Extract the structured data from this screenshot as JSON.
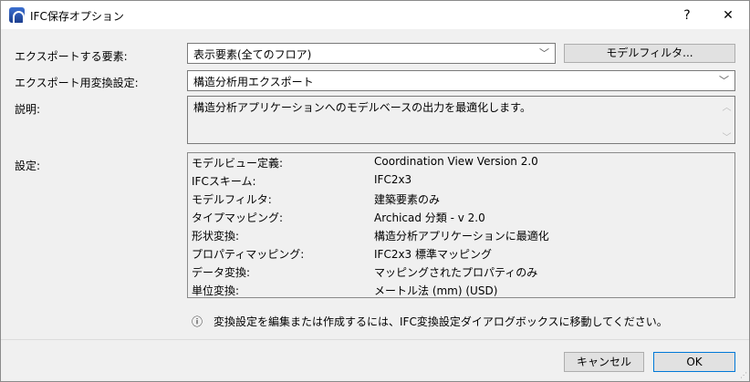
{
  "window": {
    "title": "IFC保存オプション",
    "help": "?",
    "close": "✕"
  },
  "form": {
    "elements_label": "エクスポートする要素:",
    "elements_value": "表示要素(全てのフロア)",
    "model_filter_button": "モデルフィルタ...",
    "translator_label": "エクスポート用変換設定:",
    "translator_value": "構造分析用エクスポート",
    "description_label": "説明:",
    "description_value": "構造分析アプリケーションへのモデルベースの出力を最適化します。",
    "settings_label": "設定:"
  },
  "settings": [
    {
      "key": "モデルビュー定義:",
      "value": "Coordination View Version 2.0"
    },
    {
      "key": "IFCスキーム:",
      "value": "IFC2x3"
    },
    {
      "key": "モデルフィルタ:",
      "value": "建築要素のみ"
    },
    {
      "key": "タイプマッピング:",
      "value": "Archicad 分類 - v 2.0"
    },
    {
      "key": "形状変換:",
      "value": "構造分析アプリケーションに最適化"
    },
    {
      "key": "プロパティマッピング:",
      "value": "IFC2x3 標準マッピング"
    },
    {
      "key": "データ変換:",
      "value": "マッピングされたプロパティのみ"
    },
    {
      "key": "単位変換:",
      "value": "メートル法 (mm) (USD)"
    }
  ],
  "info": {
    "icon": "ⓘ",
    "text": "変換設定を編集または作成するには、IFC変換設定ダイアログボックスに移動してください。"
  },
  "buttons": {
    "cancel": "キャンセル",
    "ok": "OK"
  }
}
